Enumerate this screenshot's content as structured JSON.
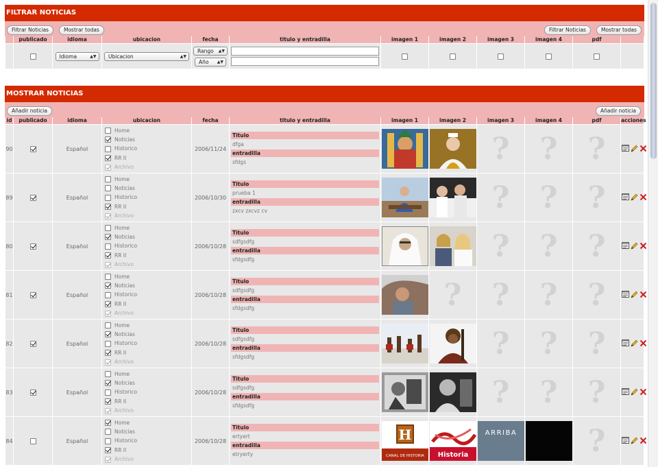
{
  "filter": {
    "title": "FILTRAR NOTICIAS",
    "btn_filter": "Filtrar Noticias",
    "btn_show_all": "Mostrar todas",
    "headers": [
      "publicado",
      "idioma",
      "ubicacion",
      "fecha",
      "titulo y entradilla",
      "imagen 1",
      "imagen 2",
      "imagen 3",
      "imagen 4",
      "pdf"
    ],
    "idioma_value": "Idioma",
    "ubicacion_value": "Ubicacion",
    "rango_value": "Rango",
    "anio_value": "Año"
  },
  "list": {
    "title": "MOSTRAR NOTICIAS",
    "btn_add": "Añadir noticia",
    "headers": [
      "id",
      "publicado",
      "idioma",
      "ubicacion",
      "fecha",
      "titulo y entradilla",
      "imagen 1",
      "imagen 2",
      "imagen 3",
      "imagen 4",
      "pdf",
      "acciones"
    ],
    "loc_labels": [
      "Home",
      "Noticias",
      "Historico",
      "RR II",
      "Archivo"
    ],
    "titulo_label": "Titulo",
    "entradilla_label": "entradilla",
    "rows": [
      {
        "id": "90",
        "pub": true,
        "lang": "Español",
        "loc": [
          false,
          true,
          false,
          true,
          true
        ],
        "date": "2006/11/24",
        "titulo": "dfga",
        "entradilla": "sfdgs",
        "imgs": [
          "img-buddhist",
          "img-pope",
          null,
          null
        ],
        "pdf": false
      },
      {
        "id": "89",
        "pub": true,
        "lang": "Español",
        "loc": [
          false,
          false,
          false,
          true,
          true
        ],
        "date": "2006/10/30",
        "titulo": "prueba 1",
        "entradilla": "zxcv zxcvz cv",
        "imgs": [
          "img-man-boat",
          "img-group",
          null,
          null
        ],
        "pdf": false
      },
      {
        "id": "80",
        "pub": true,
        "lang": "Español",
        "loc": [
          false,
          true,
          false,
          true,
          true
        ],
        "date": "2006/10/28",
        "titulo": "sdfgsdfg",
        "entradilla": "sfdgsdfg",
        "imgs": [
          "img-lawrence",
          "img-couple",
          null,
          null
        ],
        "pdf": false
      },
      {
        "id": "81",
        "pub": true,
        "lang": "Español",
        "loc": [
          false,
          true,
          false,
          true,
          true
        ],
        "date": "2006/10/28",
        "titulo": "sdfgsdfg",
        "entradilla": "sfdgsdfg",
        "imgs": [
          "img-child",
          null,
          null,
          null
        ],
        "pdf": false
      },
      {
        "id": "82",
        "pub": true,
        "lang": "Español",
        "loc": [
          false,
          true,
          false,
          true,
          true
        ],
        "date": "2006/10/28",
        "titulo": "sdfgsdfg",
        "entradilla": "sfdgsdfg",
        "imgs": [
          "img-dancers",
          "img-warrior",
          null,
          null
        ],
        "pdf": false
      },
      {
        "id": "83",
        "pub": true,
        "lang": "Español",
        "loc": [
          false,
          true,
          false,
          true,
          true
        ],
        "date": "2006/10/28",
        "titulo": "sdfgsdfg",
        "entradilla": "sfdgsdfg",
        "imgs": [
          "img-picasso",
          "img-bw-portrait",
          null,
          null
        ],
        "pdf": false
      },
      {
        "id": "84",
        "pub": false,
        "lang": "Español",
        "loc": [
          true,
          false,
          false,
          true,
          true
        ],
        "date": "2006/10/28",
        "titulo": "ertyert",
        "entradilla": "etryerty",
        "imgs": [
          "img-history-logo",
          "img-historia",
          "img-arriba",
          "img-black"
        ],
        "pdf": false
      }
    ]
  },
  "thumb_text": {
    "history_h": "H",
    "history_caption": "CANAL DE HISTORIA",
    "historia": "Historia",
    "arriba": "ARRIBA"
  },
  "colors": {
    "header_red": "#d42a00",
    "header_pink": "#f0b4b4",
    "cell_grey": "#e8e8e8",
    "delete_red": "#cc1f1f"
  }
}
